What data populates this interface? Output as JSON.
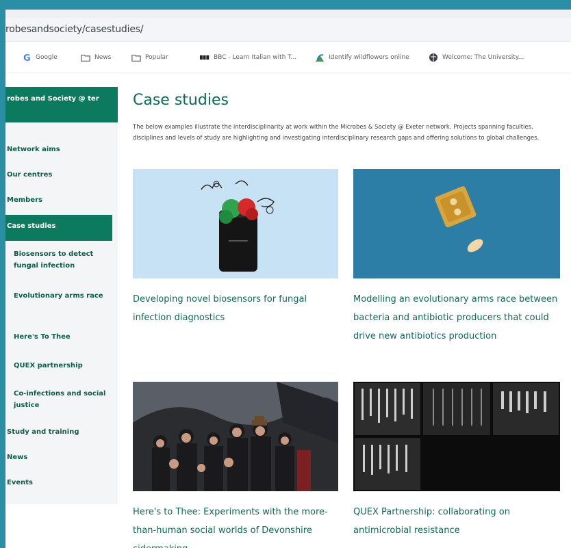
{
  "browser": {
    "url": "robesandsociety/casestudies/",
    "bookmarks": [
      {
        "label": "Google",
        "icon": "google-icon"
      },
      {
        "label": "News",
        "icon": "folder-icon"
      },
      {
        "label": "Popular",
        "icon": "folder-icon"
      },
      {
        "label": "BBC - Learn Italian with T...",
        "icon": "bbc-icon"
      },
      {
        "label": "Identify wildflowers online",
        "icon": "flower-icon"
      },
      {
        "label": "Welcome: The University...",
        "icon": "globe-icon"
      }
    ]
  },
  "sidebar": {
    "heading": "robes and Society @ ter",
    "items": [
      {
        "label": "Network aims"
      },
      {
        "label": "Our centres"
      },
      {
        "label": "Members"
      }
    ],
    "active": "Case studies",
    "subitems": [
      {
        "label": "Biosensors to detect fungal infection"
      },
      {
        "label": "Evolutionary arms race"
      },
      {
        "label": "Here's To Thee"
      },
      {
        "label": "QUEX partnership"
      },
      {
        "label": "Co-infections and social justice"
      }
    ],
    "bottom_items": [
      {
        "label": "Study and training"
      },
      {
        "label": "News"
      },
      {
        "label": "Events"
      }
    ]
  },
  "main": {
    "title": "Case studies",
    "intro": "The below examples illustrate the interdisciplinarity at work within the Microbes & Society @ Exeter network. Projects spanning faculties, disciplines and levels of study are highlighting and investigating interdisciplinary research gaps and offering solutions to global challenges.",
    "cards": [
      {
        "title": "Developing novel biosensors for fungal infection diagnostics"
      },
      {
        "title": "Modelling an evolutionary arms race between bacteria and antibiotic producers that could drive new antibiotics production"
      },
      {
        "title": "Here's to Thee: Experiments with the more-than-human social worlds of Devonshire cidermaking"
      },
      {
        "title": "QUEX Partnership: collaborating on antimicrobial resistance"
      }
    ]
  },
  "colors": {
    "accent": "#0b7a5f",
    "frame": "#2a8fa4",
    "title": "#0b6b55"
  }
}
